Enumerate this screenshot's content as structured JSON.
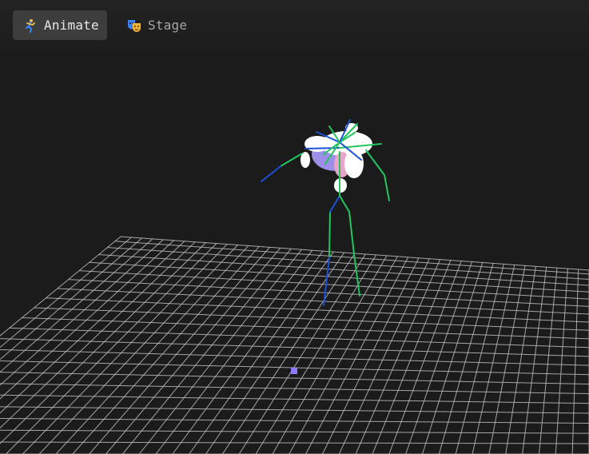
{
  "toolbar": {
    "tabs": [
      {
        "label": "Animate",
        "icon": "running-figure-icon",
        "active": true
      },
      {
        "label": "Stage",
        "icon": "theater-masks-icon",
        "active": false
      }
    ]
  },
  "viewport": {
    "background": "#1b1b1b",
    "grid_color": "#bdbdbd",
    "bone_colors": [
      "#22c55e",
      "#1d4ed8"
    ],
    "origin_marker_color": "#8b7bff"
  }
}
